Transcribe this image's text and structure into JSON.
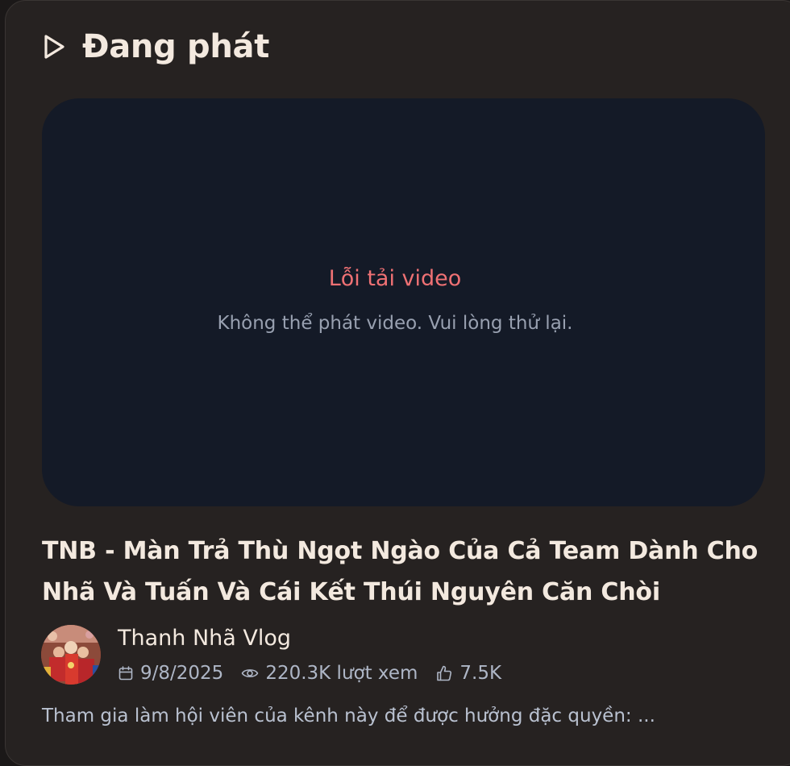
{
  "header": {
    "title": "Đang phát",
    "icon": "play-icon"
  },
  "player": {
    "error_title": "Lỗi tải video",
    "error_message": "Không thể phát video. Vui lòng thử lại."
  },
  "video": {
    "title": "TNB - Màn Trả Thù Ngọt Ngào Của Cả Team Dành Cho Nhã Và Tuấn Và Cái Kết Thúi Nguyên Căn Chòi",
    "channel_name": "Thanh Nhã Vlog",
    "date": "9/8/2025",
    "views": "220.3K lượt xem",
    "likes": "7.5K",
    "description": "Tham gia làm hội viên của kênh này để được hưởng đặc quyền: ..."
  },
  "colors": {
    "background": "#262221",
    "player_background": "#141a27",
    "error_accent": "#ef7174",
    "title_text": "#f3e9df"
  }
}
